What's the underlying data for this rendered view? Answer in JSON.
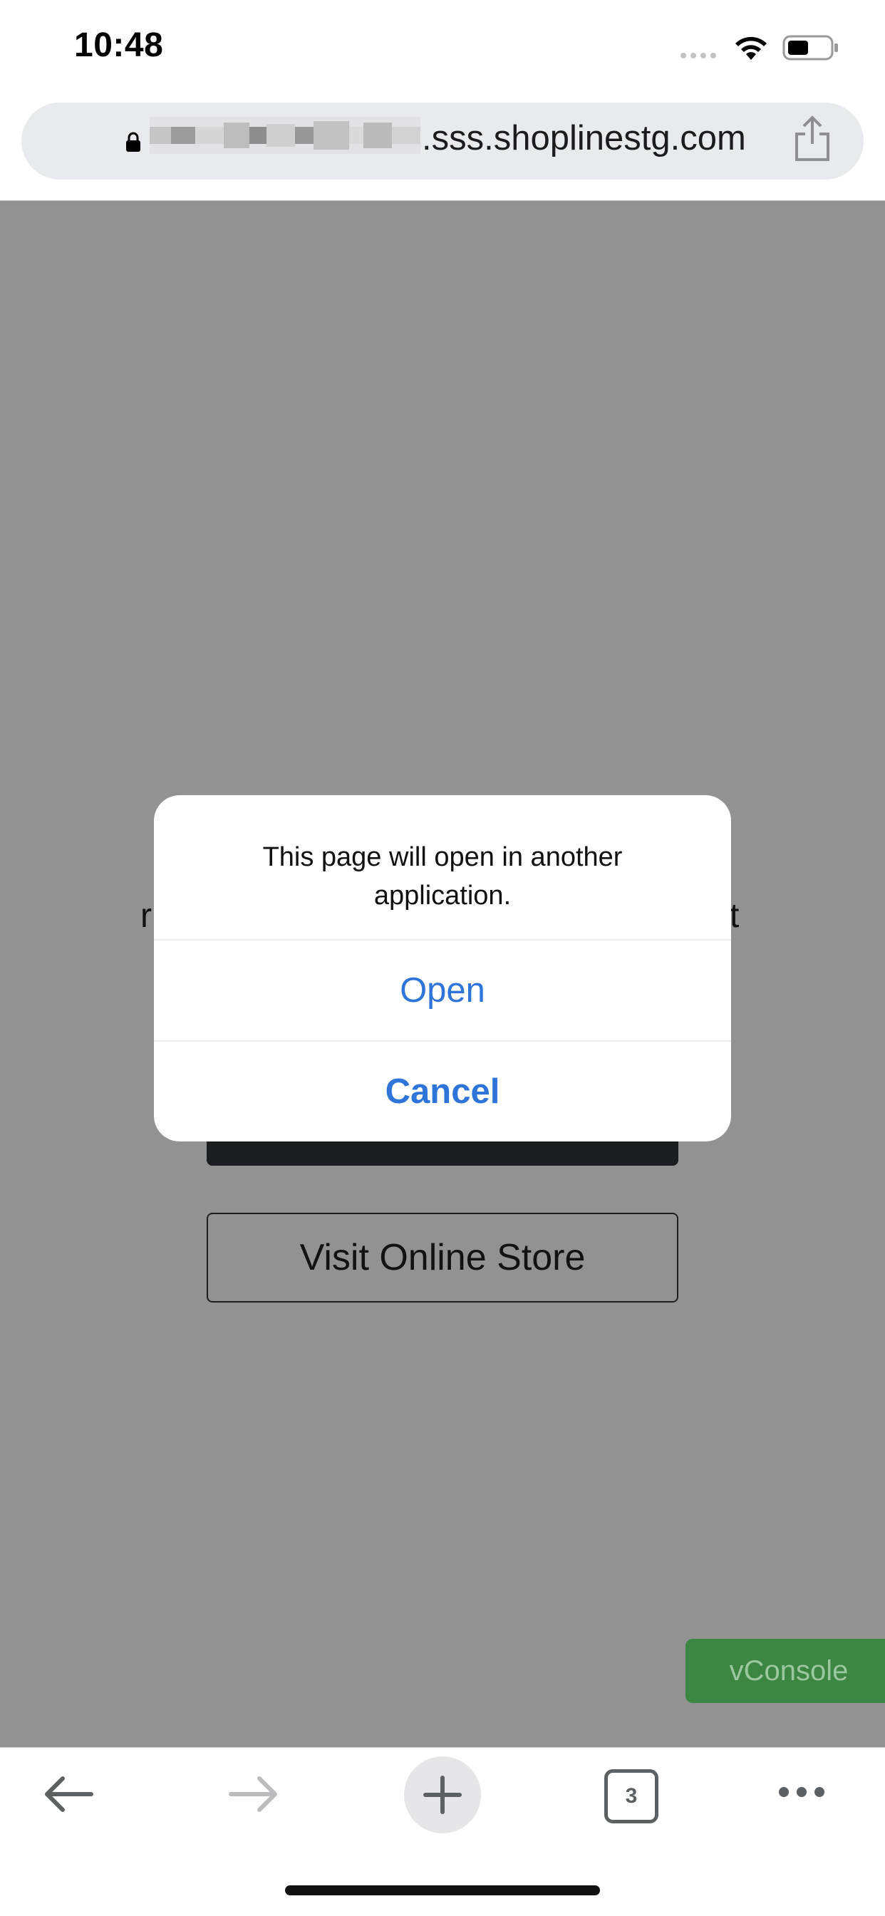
{
  "status_bar": {
    "time": "10:48",
    "icons": [
      "cellular-dots-icon",
      "wifi-icon",
      "battery-icon"
    ]
  },
  "url_bar": {
    "domain_suffix": ".sss.shoplinestg.com",
    "icons": [
      "lock-icon",
      "share-icon"
    ]
  },
  "page": {
    "background_text_left": "r",
    "background_text_right": "t",
    "visit_store_label": "Visit Online Store",
    "vconsole_label": "vConsole"
  },
  "dialog": {
    "message": "This page will open in another application.",
    "open_label": "Open",
    "cancel_label": "Cancel"
  },
  "toolbar": {
    "tab_count": "3",
    "icons": [
      "back-arrow-icon",
      "forward-arrow-icon",
      "plus-icon",
      "tabs-icon",
      "more-icon"
    ]
  },
  "colors": {
    "dialog_action": "#2e74d9",
    "overlay": "#929292",
    "vconsole": "#3c8543"
  }
}
